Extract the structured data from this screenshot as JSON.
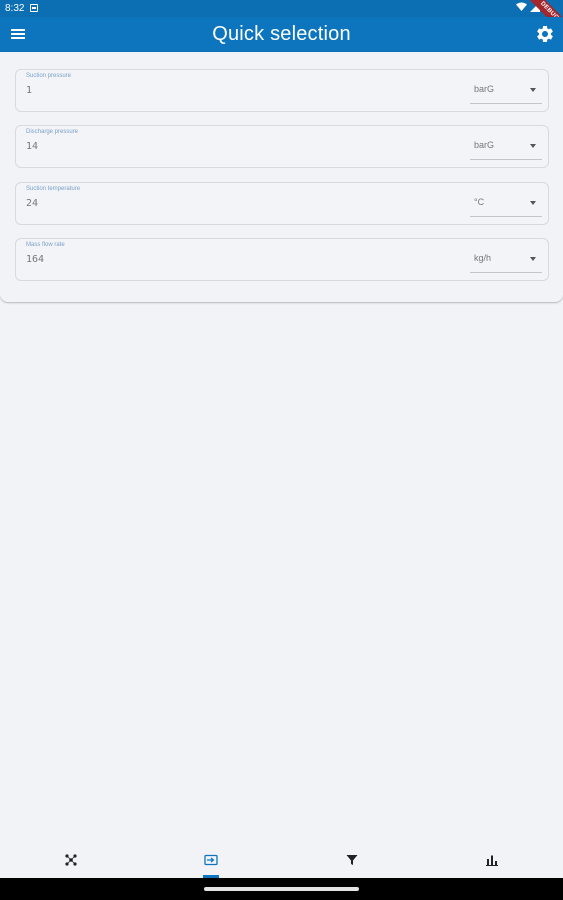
{
  "status_bar": {
    "time": "8:32",
    "icons": [
      "notification-icon",
      "wifi-icon",
      "signal-icon",
      "battery-icon"
    ],
    "debug_banner": "DEBUG"
  },
  "app_bar": {
    "title": "Quick selection",
    "menu_icon": "menu-icon",
    "settings_icon": "gear-icon",
    "color": "#0d75bd"
  },
  "form": {
    "fields": [
      {
        "label": "Suction pressure",
        "value": "1",
        "unit": "barG"
      },
      {
        "label": "Discharge pressure",
        "value": "14",
        "unit": "barG"
      },
      {
        "label": "Suction temperature",
        "value": "24",
        "unit": "°C"
      },
      {
        "label": "Mass flow rate",
        "value": "164",
        "unit": "kg/h"
      }
    ]
  },
  "bottom_nav": {
    "items": [
      {
        "icon": "molecule-icon",
        "active": false
      },
      {
        "icon": "input-icon",
        "active": true
      },
      {
        "icon": "filter-icon",
        "active": false
      },
      {
        "icon": "bar-chart-icon",
        "active": false
      }
    ],
    "active_color": "#0d75bd"
  }
}
